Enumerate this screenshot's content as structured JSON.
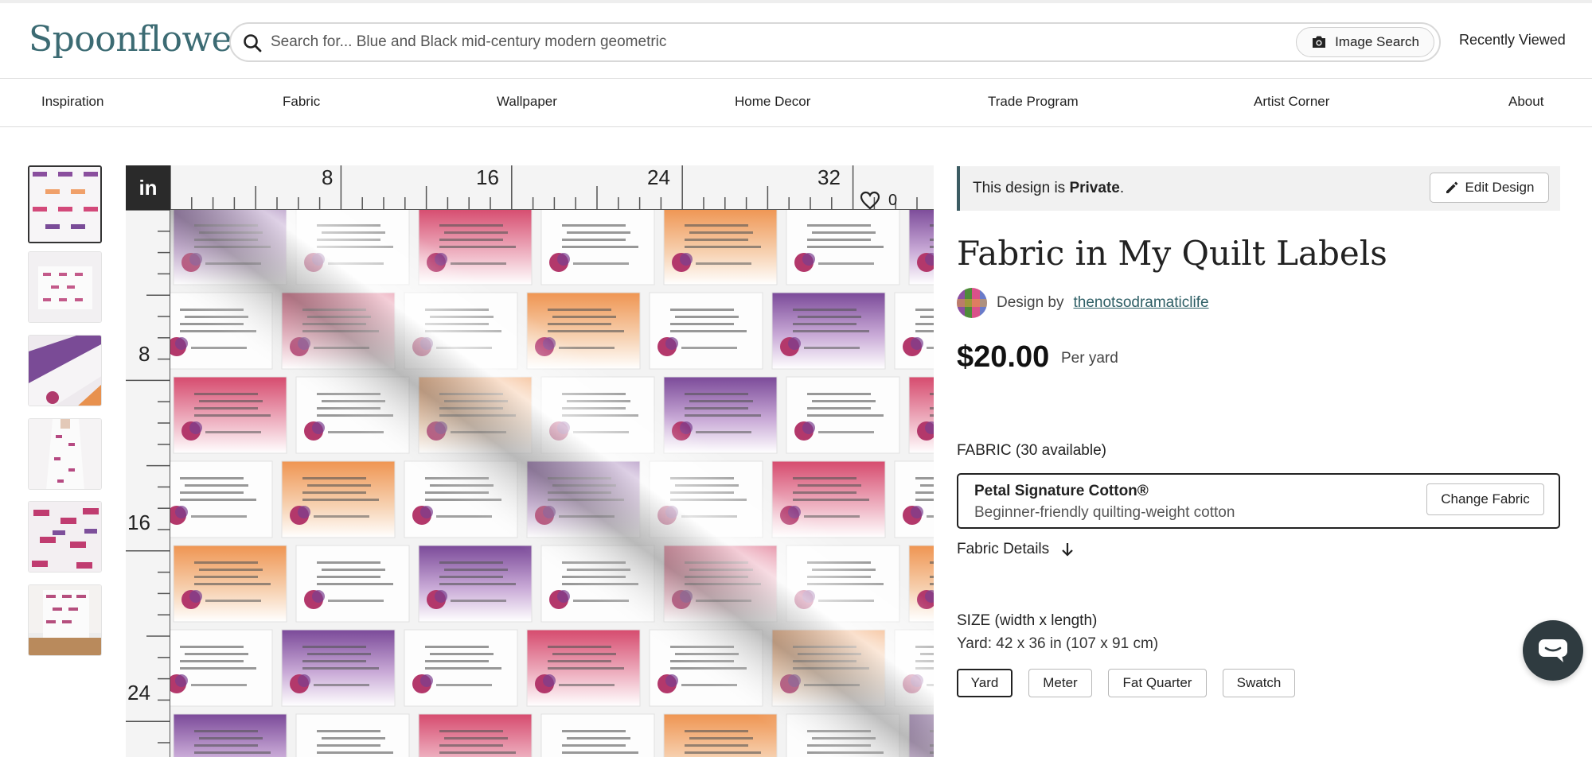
{
  "header": {
    "logo": "Spoonflower",
    "search_placeholder": "Search for... Blue and Black mid-century modern geometric",
    "image_search_label": "Image Search",
    "recently_viewed": "Recently Viewed"
  },
  "nav": {
    "items": [
      "Inspiration",
      "Fabric",
      "Wallpaper",
      "Home Decor",
      "Trade Program",
      "Artist Corner",
      "About"
    ]
  },
  "preview": {
    "unit": "in",
    "ruler_top": [
      "8",
      "16",
      "24",
      "32"
    ],
    "ruler_left": [
      "8",
      "16",
      "24"
    ],
    "favorites_count": "0"
  },
  "notice": {
    "prefix": "This design is ",
    "status": "Private",
    "suffix": ".",
    "edit_label": "Edit Design"
  },
  "product": {
    "title": "Fabric in My Quilt Labels",
    "design_by": "Design by",
    "designer": "thenotsodramaticlife",
    "price": "$20.00",
    "price_unit": "Per yard"
  },
  "fabric": {
    "label": "FABRIC (30 available)",
    "name": "Petal Signature Cotton®",
    "description": "Beginner-friendly quilting-weight cotton",
    "change_label": "Change Fabric",
    "details_label": "Fabric Details"
  },
  "size": {
    "label": "SIZE (width x length)",
    "value": "Yard: 42 x 36 in (107 x 91 cm)",
    "options": [
      "Yard",
      "Meter",
      "Fat Quarter",
      "Swatch"
    ],
    "selected": "Yard"
  },
  "colors": {
    "brand": "#3c6b73",
    "notice_bar": "#3c5c63",
    "chat": "#2f3b40"
  }
}
